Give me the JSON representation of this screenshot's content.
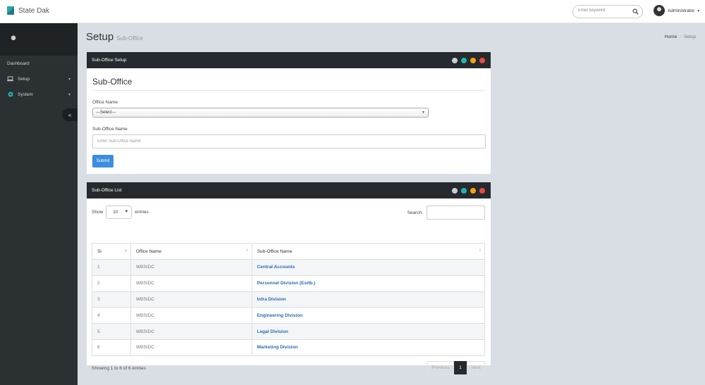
{
  "app": {
    "title": "State Dak"
  },
  "header": {
    "search_placeholder": "Enter keyword",
    "user_name": "Administrator"
  },
  "sidebar": {
    "items": [
      {
        "label": "Dashboard"
      },
      {
        "label": "Setup"
      },
      {
        "label": "System"
      }
    ]
  },
  "page": {
    "title": "Setup",
    "subtitle": "Sub-Office",
    "breadcrumb": [
      "Home",
      "Setup"
    ]
  },
  "form_panel": {
    "title": "Sub-Office Setup",
    "heading": "Sub-Office",
    "office_label": "Office Name",
    "office_value": "---Select---",
    "suboffice_label": "Sub-Office Name",
    "suboffice_placeholder": "Enter Sub-Office Name",
    "submit_label": "Submit"
  },
  "list_panel": {
    "title": "Sub-Office List",
    "show_label": "Show",
    "page_length": "10",
    "entries_label": "entries",
    "search_label": "Search:",
    "columns": [
      "Sl",
      "Office Name",
      "Sub-Office Name"
    ],
    "rows": [
      {
        "sl": "1",
        "office": "WBSIDC",
        "suboffice": "Central Accounts"
      },
      {
        "sl": "2",
        "office": "WBSIDC",
        "suboffice": "Personnel Division (Esttb.)"
      },
      {
        "sl": "3",
        "office": "WBSIDC",
        "suboffice": "Infra Division"
      },
      {
        "sl": "4",
        "office": "WBSIDC",
        "suboffice": "Engineering Division"
      },
      {
        "sl": "5",
        "office": "WBSIDC",
        "suboffice": "Legal Division"
      },
      {
        "sl": "6",
        "office": "WBSIDC",
        "suboffice": "Marketing Division"
      }
    ],
    "info": "Showing 1 to 6 of 6 entries",
    "pagination": {
      "previous": "Previous",
      "current": "1",
      "next": "Next"
    }
  },
  "colors": {
    "panel_header": "#262a2e",
    "dot_1": "#c7cdd2",
    "dot_2": "#1fb5ad",
    "dot_3": "#f0a30a",
    "dot_4": "#e74c3c",
    "submit": "#3c8dde",
    "link": "#2a6bb3"
  }
}
